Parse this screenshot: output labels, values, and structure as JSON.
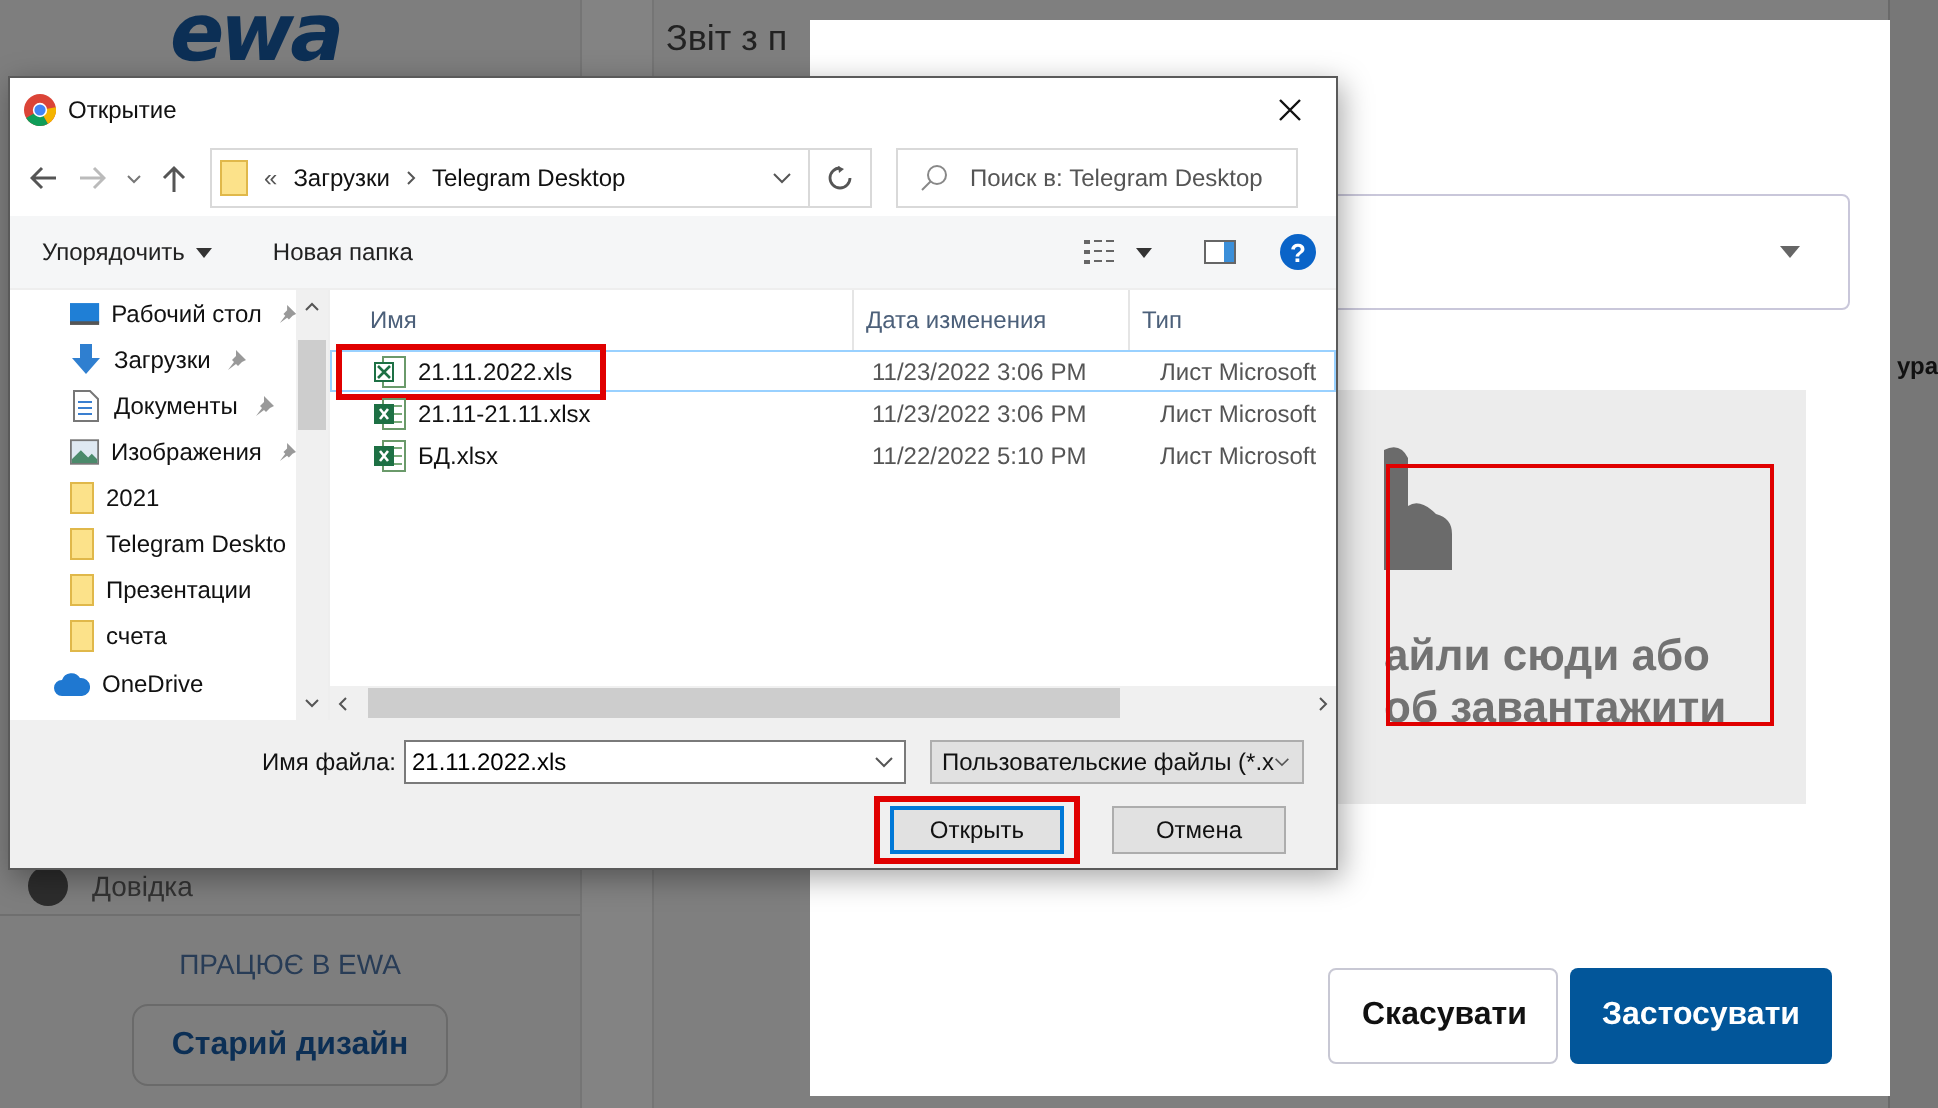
{
  "page": {
    "logo": "ewa",
    "header_title": "Звіт з п",
    "help_item": "Довідка",
    "caption": "ПРАЦЮЄ В EWA",
    "old_design_button": "Старий дизайн",
    "edge_text": "ура"
  },
  "modal": {
    "drop_zone": {
      "lines": [
        "айли сюди або",
        "об завантажити"
      ],
      "highlighted": true
    },
    "buttons": [
      {
        "label": "Скасувати",
        "kind": "secondary"
      },
      {
        "label": "Застосувати",
        "kind": "primary"
      }
    ]
  },
  "dialog": {
    "title": "Открытие",
    "address": {
      "overflow": "«",
      "segments": [
        "Загрузки",
        "Telegram Desktop"
      ]
    },
    "search": {
      "placeholder": "Поиск в: Telegram Desktop"
    },
    "toolbar": [
      {
        "label": "Упорядочить",
        "kind": "menu"
      },
      {
        "label": "Новая папка",
        "kind": "button"
      }
    ],
    "help_glyph": "?",
    "nav_items": [
      {
        "label": "Рабочий стол",
        "kind": "desktop",
        "pinned": true
      },
      {
        "label": "Загрузки",
        "kind": "download",
        "pinned": true
      },
      {
        "label": "Документы",
        "kind": "document",
        "pinned": true
      },
      {
        "label": "Изображения",
        "kind": "image",
        "pinned": true
      },
      {
        "label": "2021",
        "kind": "folder",
        "pinned": false
      },
      {
        "label": "Telegram Deskto",
        "kind": "folder",
        "pinned": false
      },
      {
        "label": "Презентации",
        "kind": "folder",
        "pinned": false
      },
      {
        "label": "счета",
        "kind": "folder",
        "pinned": false
      },
      {
        "label": "OneDrive",
        "kind": "cloud",
        "pinned": false
      }
    ],
    "columns": [
      "Имя",
      "Дата изменения",
      "Тип"
    ],
    "files": [
      {
        "name": "21.11.2022.xls",
        "modified": "11/23/2022 3:06 PM",
        "type": "Лист Microsoft",
        "kind": "xls",
        "selected": true,
        "highlighted": true
      },
      {
        "name": "21.11-21.11.xlsx",
        "modified": "11/23/2022 3:06 PM",
        "type": "Лист Microsoft",
        "kind": "xlsx",
        "selected": false,
        "highlighted": false
      },
      {
        "name": "БД.xlsx",
        "modified": "11/22/2022 5:10 PM",
        "type": "Лист Microsoft",
        "kind": "xlsx",
        "selected": false,
        "highlighted": false
      }
    ],
    "file_name_label": "Имя файла:",
    "file_name": "21.11.2022.xls",
    "file_type": "Пользовательские файлы (*.x",
    "buttons": [
      {
        "label": "Открыть",
        "kind": "default",
        "highlighted": true
      },
      {
        "label": "Отмена",
        "kind": "normal",
        "highlighted": false
      }
    ]
  }
}
